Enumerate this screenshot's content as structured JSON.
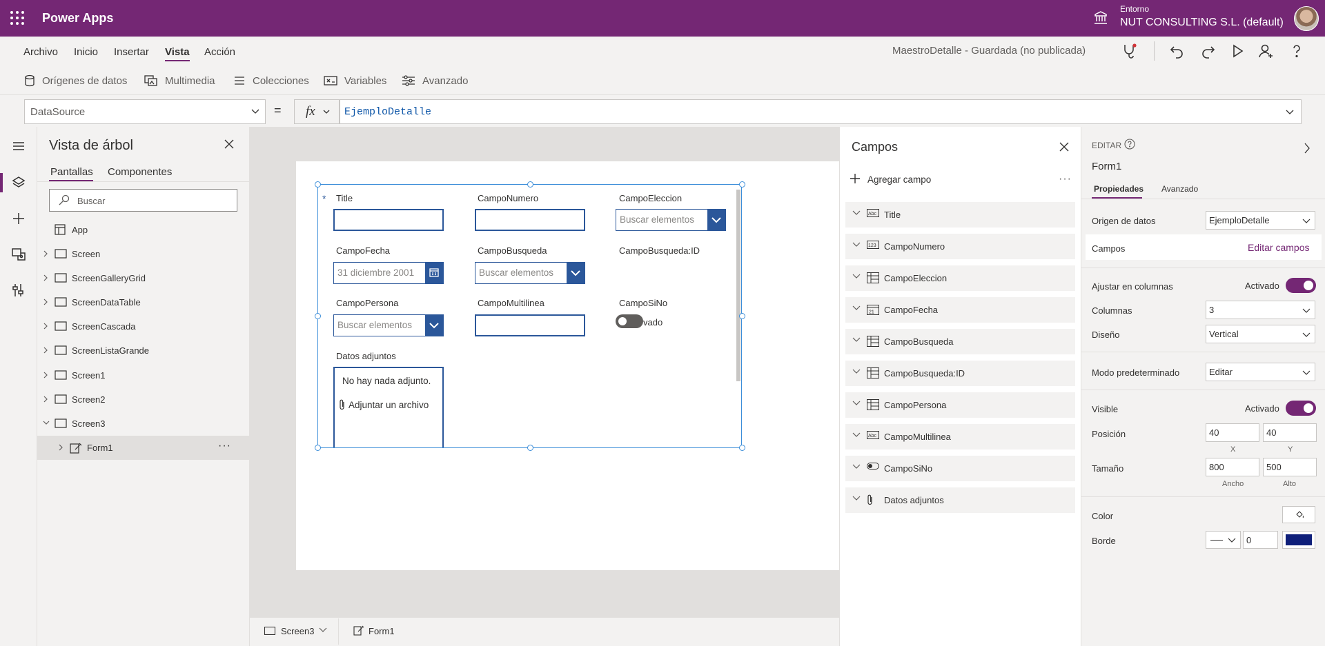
{
  "header": {
    "app_title": "Power Apps",
    "env_label": "Entorno",
    "env_name": "NUT CONSULTING S.L. (default)"
  },
  "menu": {
    "items": [
      "Archivo",
      "Inicio",
      "Insertar",
      "Vista",
      "Acción"
    ],
    "active": "Vista",
    "doc_status": "MaestroDetalle - Guardada (no publicada)"
  },
  "ribbon": {
    "items": [
      "Orígenes de datos",
      "Multimedia",
      "Colecciones",
      "Variables",
      "Avanzado"
    ]
  },
  "formula_bar": {
    "property": "DataSource",
    "equals": "=",
    "fx": "fx",
    "formula": "EjemploDetalle"
  },
  "tree": {
    "title": "Vista de árbol",
    "tabs": [
      "Pantallas",
      "Componentes"
    ],
    "search_placeholder": "Buscar",
    "items": [
      "App",
      "Screen",
      "ScreenGalleryGrid",
      "ScreenDataTable",
      "ScreenCascada",
      "ScreenListaGrande",
      "Screen1",
      "Screen2",
      "Screen3",
      "Form1"
    ],
    "more": "···"
  },
  "form": {
    "labels": {
      "title": "Title",
      "campo_numero": "CampoNumero",
      "campo_eleccion": "CampoEleccion",
      "campo_fecha": "CampoFecha",
      "campo_busqueda": "CampoBusqueda",
      "campo_busqueda_id": "CampoBusqueda:ID",
      "campo_persona": "CampoPersona",
      "campo_multilinea": "CampoMultilinea",
      "campo_sino": "CampoSiNo",
      "datos_adjuntos": "Datos adjuntos"
    },
    "required_mark": "*",
    "search_placeholder": "Buscar elementos",
    "date_value": "31 diciembre 2001",
    "toggle_text": "vado",
    "no_attachments": "No hay nada adjunto.",
    "attach_link": "Adjuntar un archivo"
  },
  "statusbar": {
    "screen": "Screen3",
    "control": "Form1"
  },
  "fields_panel": {
    "title": "Campos",
    "add_label": "Agregar campo",
    "more": "···",
    "fields": [
      {
        "label": "Title",
        "icon": "text-field-icon"
      },
      {
        "label": "CampoNumero",
        "icon": "number-field-icon"
      },
      {
        "label": "CampoEleccion",
        "icon": "choice-field-icon"
      },
      {
        "label": "CampoFecha",
        "icon": "date-field-icon"
      },
      {
        "label": "CampoBusqueda",
        "icon": "lookup-field-icon"
      },
      {
        "label": "CampoBusqueda:ID",
        "icon": "lookup-field-icon"
      },
      {
        "label": "CampoPersona",
        "icon": "person-field-icon"
      },
      {
        "label": "CampoMultilinea",
        "icon": "text-field-icon"
      },
      {
        "label": "CampoSiNo",
        "icon": "toggle-field-icon"
      },
      {
        "label": "Datos adjuntos",
        "icon": "attachment-icon"
      }
    ]
  },
  "props": {
    "edit_label": "EDITAR",
    "control_name": "Form1",
    "tabs": [
      "Propiedades",
      "Avanzado"
    ],
    "data_source_label": "Origen de datos",
    "data_source_value": "EjemploDetalle",
    "fields_label": "Campos",
    "fields_link": "Editar campos",
    "snap_label": "Ajustar en columnas",
    "snap_state": "Activado",
    "columns_label": "Columnas",
    "columns_value": "3",
    "layout_label": "Diseño",
    "layout_value": "Vertical",
    "default_mode_label": "Modo predeterminado",
    "default_mode_value": "Editar",
    "visible_label": "Visible",
    "visible_state": "Activado",
    "position_label": "Posición",
    "pos_x": "40",
    "pos_y": "40",
    "x_cap": "X",
    "y_cap": "Y",
    "size_label": "Tamaño",
    "width": "800",
    "height": "500",
    "width_cap": "Ancho",
    "height_cap": "Alto",
    "color_label": "Color",
    "border_label": "Borde",
    "border_width": "0",
    "border_color": "#0f1f7a"
  },
  "colors": {
    "brand": "#742774",
    "form_accent": "#2b579a"
  }
}
